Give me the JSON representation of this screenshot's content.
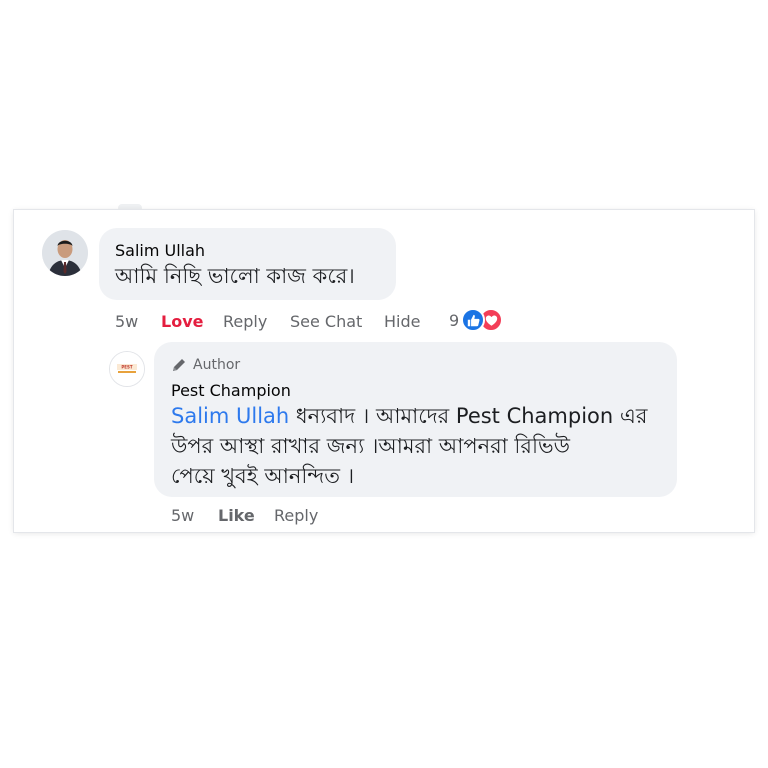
{
  "comment": {
    "author": "Salim Ullah",
    "text": "আমি নিছি ভালো কাজ করে।",
    "time": "5w",
    "actions": {
      "love": "Love",
      "reply": "Reply",
      "see_chat": "See Chat",
      "hide": "Hide"
    },
    "reactions": {
      "count": "9"
    }
  },
  "reply": {
    "badge": "Author",
    "author": "Pest Champion",
    "mention": "Salim Ullah",
    "line1_rest": " ধন্যবাদ । আমাদের Pest Champion এর",
    "line2": "উপর আস্থা রাখার জন্য ।আমরা আপনরা রিভিউ",
    "line3": "পেয়ে খুবই আনন্দিত ।",
    "time": "5w",
    "actions": {
      "like": "Like",
      "reply": "Reply"
    },
    "avatar_text": "PEST"
  },
  "colors": {
    "love": "#e41e3f",
    "mention": "#2d79ed",
    "like": "#1b74e4",
    "heart": "#f33e58",
    "bubble": "#f0f2f5"
  }
}
